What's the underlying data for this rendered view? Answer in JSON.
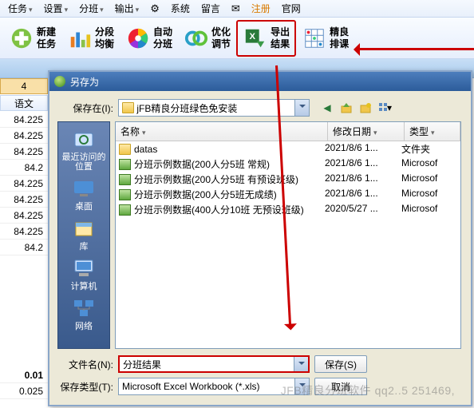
{
  "menu": {
    "tasks": "任务",
    "settings": "设置",
    "class": "分班",
    "output": "输出",
    "sys": "系统",
    "board": "留言",
    "reg": "注册",
    "site": "官网"
  },
  "toolbar": [
    {
      "label": "新建\n任务",
      "name": "new-task-button"
    },
    {
      "label": "分段\n均衡",
      "name": "balance-button"
    },
    {
      "label": "自动\n分班",
      "name": "auto-class-button"
    },
    {
      "label": "优化\n调节",
      "name": "optimize-button"
    },
    {
      "label": "导出\n结果",
      "name": "export-button",
      "hl": true
    },
    {
      "label": "精良\n排课",
      "name": "schedule-button"
    }
  ],
  "grid": {
    "header_sel": "4",
    "header_sub": "语文",
    "rows": [
      "84.225",
      "84.225",
      "84.225",
      "84.2",
      "84.225",
      "84.225",
      "84.225",
      "84.225",
      "84.2"
    ],
    "gap_rows": [
      "0.01",
      "0.025"
    ]
  },
  "dialog": {
    "title": "另存为",
    "save_in": "保存在(I):",
    "folder": "jFB精良分班绿色免安装",
    "cols": {
      "name": "名称",
      "date": "修改日期",
      "type": "类型"
    },
    "places": {
      "recent": "最近访问的位置",
      "desktop": "桌面",
      "lib": "库",
      "computer": "计算机",
      "network": "网络"
    },
    "files": [
      {
        "name": "datas",
        "date": "2021/8/6 1...",
        "type": "文件夹",
        "kind": "fold"
      },
      {
        "name": "分班示例数据(200人分5班 常规)",
        "date": "2021/8/6 1...",
        "type": "Microsof",
        "kind": "xls"
      },
      {
        "name": "分班示例数据(200人分5班 有预设班级)",
        "date": "2021/8/6 1...",
        "type": "Microsof",
        "kind": "xls"
      },
      {
        "name": "分班示例数据(200人分5班无成绩)",
        "date": "2021/8/6 1...",
        "type": "Microsof",
        "kind": "xls"
      },
      {
        "name": "分班示例数据(400人分10班 无预设班级)",
        "date": "2020/5/27 ...",
        "type": "Microsof",
        "kind": "xls"
      }
    ],
    "file_label": "文件名(N):",
    "file_value": "分班结果",
    "type_label": "保存类型(T):",
    "type_value": "Microsoft Excel Workbook (*.xls)",
    "save_btn": "保存(S)",
    "cancel_btn": "取消"
  },
  "watermark": "JFB精良分班软件 qq2..5  251469,"
}
